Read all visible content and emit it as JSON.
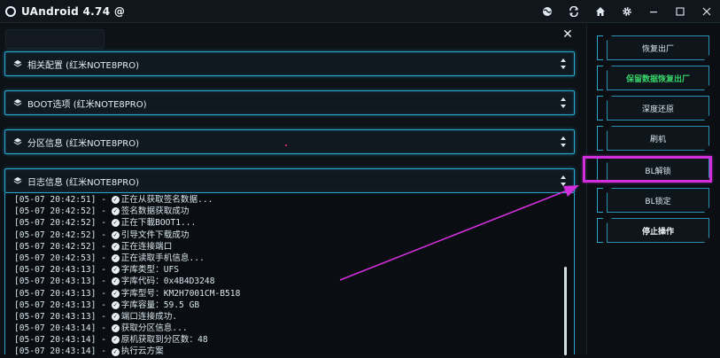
{
  "window": {
    "title": "UAndroid 4.74 @",
    "controls": [
      "globe-icon",
      "refresh-icon",
      "home-icon",
      "gear-icon",
      "minimize-icon",
      "maximize-icon",
      "close-icon"
    ]
  },
  "sections": [
    {
      "label": "相关配置 (红米NOTE8PRO)"
    },
    {
      "label": "BOOT选项 (红米NOTE8PRO)"
    },
    {
      "label": "分区信息 (红米NOTE8PRO)"
    },
    {
      "label": "日志信息 (红米NOTE8PRO)"
    }
  ],
  "log": [
    {
      "time": "[05-07 20:42:51] -",
      "msg": "正在从获取签名数据..."
    },
    {
      "time": "[05-07 20:42:52] -",
      "msg": "签名数据获取成功"
    },
    {
      "time": "[05-07 20:42:52] -",
      "msg": "正在下載BOOT1..."
    },
    {
      "time": "[05-07 20:42:52] -",
      "msg": "引导文件下载成功"
    },
    {
      "time": "[05-07 20:42:52] -",
      "msg": "正在连接端口"
    },
    {
      "time": "[05-07 20:42:53] -",
      "msg": "正在读取手机信息..."
    },
    {
      "time": "[05-07 20:43:13] -",
      "msg": "字库类型：UFS"
    },
    {
      "time": "[05-07 20:43:13] -",
      "msg": "字库代码：0x4B4D3248"
    },
    {
      "time": "[05-07 20:43:13] -",
      "msg": "字库型号：KM2H7001CM-B518"
    },
    {
      "time": "[05-07 20:43:13] -",
      "msg": "字库容量：59.5 GB"
    },
    {
      "time": "[05-07 20:43:13] -",
      "msg": "端口连接成功."
    },
    {
      "time": "[05-07 20:43:14] -",
      "msg": "获取分区信息..."
    },
    {
      "time": "[05-07 20:43:14] -",
      "msg": "原机获取到分区数：48"
    },
    {
      "time": "[05-07 20:43:14] -",
      "msg": "执行云方案"
    }
  ],
  "actions": [
    {
      "label": "恢复出厂",
      "style": "normal"
    },
    {
      "label": "保留数据恢复出厂",
      "style": "green"
    },
    {
      "label": "深度还原",
      "style": "normal"
    },
    {
      "label": "刷机",
      "style": "normal"
    },
    {
      "label": "BL解锁",
      "style": "normal"
    },
    {
      "label": "BL锁定",
      "style": "normal"
    },
    {
      "label": "停止操作",
      "style": "bold"
    }
  ],
  "colors": {
    "accent": "#2aa6cf",
    "highlight": "#d22fdc",
    "green_text": "#39d66a",
    "background": "#0b0f14"
  }
}
